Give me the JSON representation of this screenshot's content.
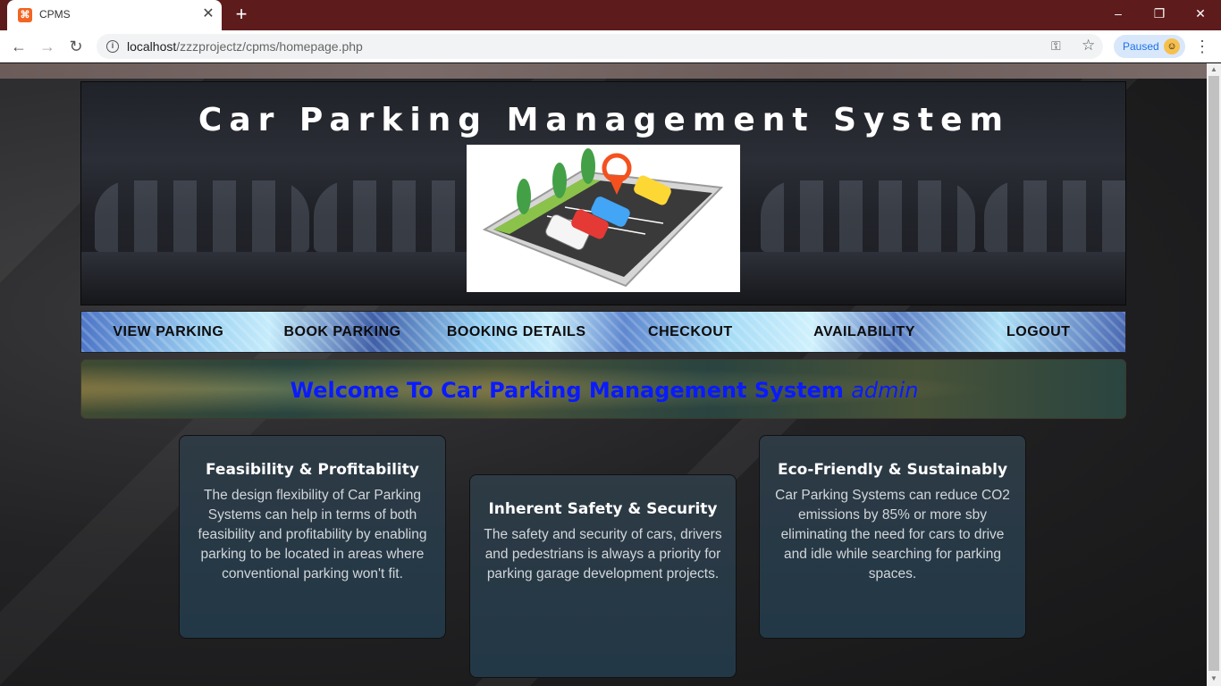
{
  "browser": {
    "tab_title": "CPMS",
    "tab_favicon": "xampp-icon",
    "new_tab": "+",
    "url_host": "localhost",
    "url_path": "/zzzprojectz/cpms/homepage.php",
    "profile_label": "Paused",
    "win_minimize": "–",
    "win_restore": "❐",
    "win_close": "✕"
  },
  "header": {
    "title": "Car Parking Management System"
  },
  "nav": {
    "items": [
      "VIEW PARKING",
      "BOOK PARKING",
      "BOOKING DETAILS",
      "CHECKOUT",
      "AVAILABILITY",
      "LOGOUT"
    ]
  },
  "welcome": {
    "message": "Welcome To Car Parking Management System",
    "user": "admin"
  },
  "cards": [
    {
      "title": "Feasibility & Profitability",
      "text": "The design flexibility of Car Parking Systems can help in terms of both feasibility and profitability by enabling parking to be located in areas where conventional parking won't fit."
    },
    {
      "title": "Inherent Safety & Security",
      "text": "The safety and security of cars, drivers and pedestrians is always a priority for parking garage development projects."
    },
    {
      "title": "Eco-Friendly & Sustainably",
      "text": "Car Parking Systems can reduce CO2 emissions by 85% or more sby eliminating the need for cars to drive and idle while searching for parking spaces."
    }
  ],
  "colors": {
    "tabbar": "#5e1b1c",
    "welcome_text": "#0a1aff",
    "card_bg": "#223847"
  }
}
